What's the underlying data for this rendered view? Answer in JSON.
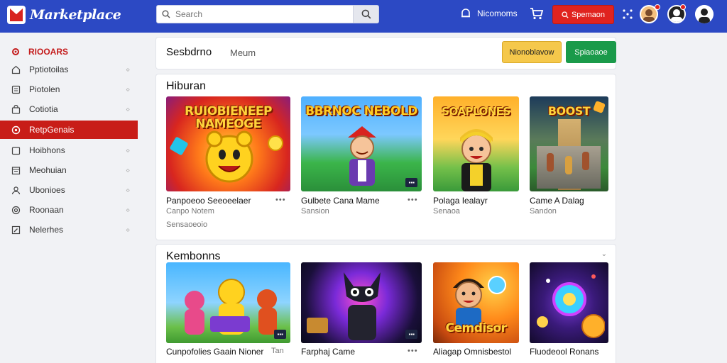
{
  "app": {
    "name": "Marketplace"
  },
  "search": {
    "placeholder": "Search"
  },
  "topbar": {
    "notifications_label": "Nicomoms",
    "red_button_label": "Spemaon"
  },
  "sidebar": {
    "header": "RIOOARS",
    "items": [
      {
        "label": "Pptiotoilas",
        "icon": "home-icon"
      },
      {
        "label": "Piotolen",
        "icon": "book-icon"
      },
      {
        "label": "Cotiotia",
        "icon": "bag-icon"
      },
      {
        "label": "RetpGenais",
        "icon": "controller-icon",
        "active": true
      },
      {
        "label": "Hoibhons",
        "icon": "folder-icon"
      },
      {
        "label": "Meohuian",
        "icon": "calendar-icon"
      },
      {
        "label": "Ubonioes",
        "icon": "user-icon"
      },
      {
        "label": "Roonaan",
        "icon": "eye-icon"
      },
      {
        "label": "Nelerhes",
        "icon": "edit-icon"
      }
    ]
  },
  "header_panel": {
    "title": "Sesbdrno",
    "subtitle": "Meum",
    "yellow_button": "Nionoblavow",
    "green_button": "Spiaoaoe"
  },
  "section1": {
    "title": "Hiburan",
    "cards": [
      {
        "name": "Panpoeoo Seeoeelaer",
        "sub": "Canpo Notem",
        "sub2": "Sensaoeoio",
        "thumb_title": "RUIOBIENEEP NAMEOGE",
        "badge": ""
      },
      {
        "name": "Gulbete Cana Mame",
        "sub": "Sansion",
        "thumb_title": "BBRNOC NEBOLD",
        "badge": "▪▪▪"
      },
      {
        "name": "Polaga Iealayr",
        "sub": "Senaoa",
        "thumb_title": "SOAPLONES",
        "badge": ""
      },
      {
        "name": "Came A Dalag",
        "sub": "Sandon",
        "thumb_title": "BOOST",
        "badge": ""
      }
    ]
  },
  "section2": {
    "title": "Kembonns",
    "cards": [
      {
        "name": "Cunpofolies Gaain Nioner",
        "sub": "",
        "extra": "Tan",
        "badge": "▪▪▪"
      },
      {
        "name": "Farphaj Came",
        "sub": "",
        "badge": "▪▪▪"
      },
      {
        "name": "Aliagap Omnisbestol",
        "sub": "",
        "thumb_title": "Cemdisor",
        "badge": ""
      },
      {
        "name": "Fluodeool Ronans",
        "sub": "",
        "badge": ""
      }
    ]
  },
  "colors": {
    "topbar": "#2c49c4",
    "accent_red": "#c81d18",
    "yellow": "#f5c84b",
    "green": "#1a9a4a"
  }
}
